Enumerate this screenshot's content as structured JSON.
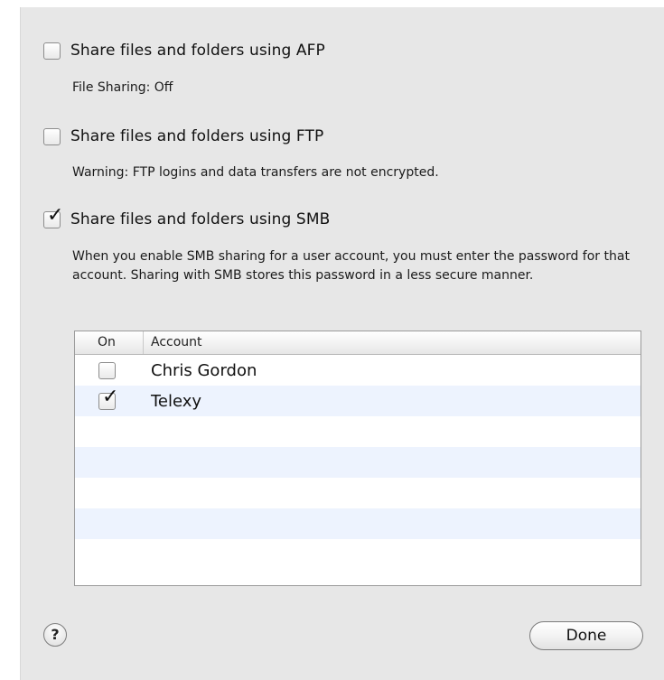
{
  "options": [
    {
      "label": "Share files and folders using AFP",
      "checked": false,
      "note": "File Sharing: Off"
    },
    {
      "label": "Share files and folders using FTP",
      "checked": false,
      "note": "Warning: FTP logins and data transfers are not encrypted."
    },
    {
      "label": "Share files and folders using SMB",
      "checked": true,
      "note": "When you enable SMB sharing for a user account, you must enter the password for that account. Sharing with SMB stores this password in a less secure manner."
    }
  ],
  "accounts_table": {
    "columns": [
      "On",
      "Account"
    ],
    "rows": [
      {
        "on": false,
        "account": "Chris Gordon"
      },
      {
        "on": true,
        "account": "Telexy"
      }
    ]
  },
  "help_button": {
    "label": "?"
  },
  "done_button": {
    "label": "Done"
  },
  "check_glyph": "✓",
  "colors": {
    "panel_background": "#e7e7e7",
    "alt_row": "#edf3fe"
  }
}
